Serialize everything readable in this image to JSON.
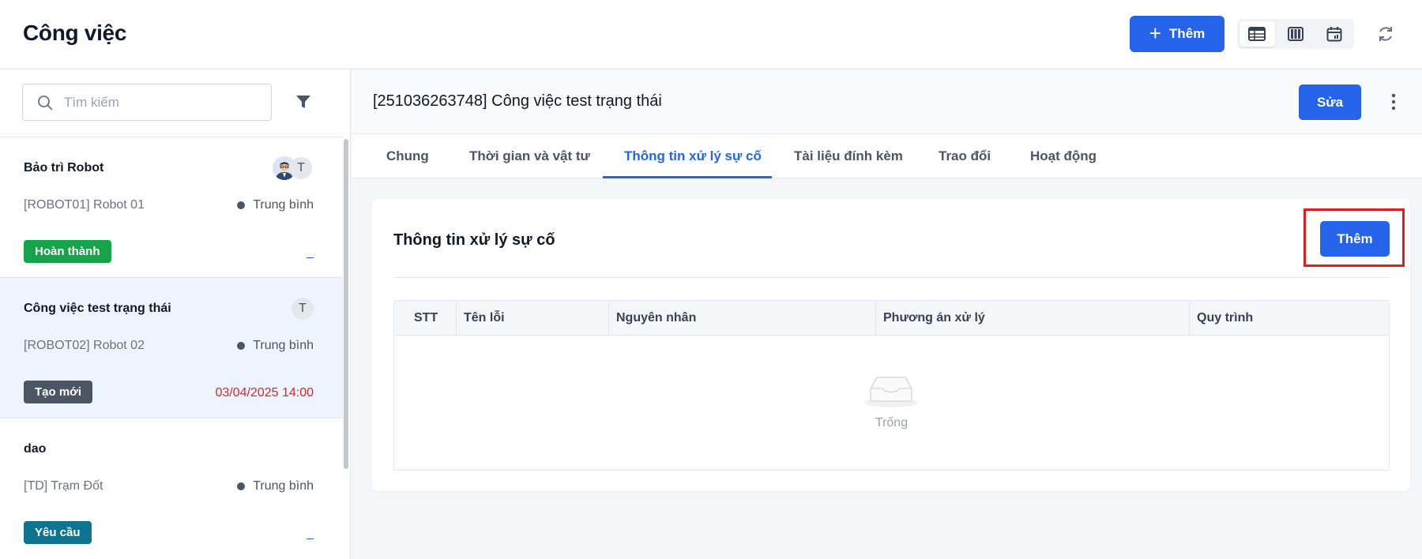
{
  "header": {
    "app_title": "Công việc",
    "add_label": "Thêm"
  },
  "search": {
    "placeholder": "Tìm kiếm"
  },
  "tasks": [
    {
      "title": "Bảo trì Robot",
      "asset": "[ROBOT01] Robot 01",
      "priority": "Trung bình",
      "status": "Hoàn thành",
      "status_color": "#16a34a",
      "date": "",
      "avatar_letter": "T"
    },
    {
      "title": "Công việc test trạng thái",
      "asset": "[ROBOT02] Robot 02",
      "priority": "Trung bình",
      "status": "Tạo mới",
      "status_color": "#4b5563",
      "date": "03/04/2025 14:00",
      "avatar_letter": "T"
    },
    {
      "title": "dao",
      "asset": "[TD] Trạm Đốt",
      "priority": "Trung bình",
      "status": "Yêu cầu",
      "status_color": "#0e7490",
      "date": "",
      "avatar_letter": ""
    }
  ],
  "detail": {
    "title": "[251036263748] Công việc test trạng thái",
    "edit_label": "Sửa",
    "tabs": [
      {
        "label": "Chung"
      },
      {
        "label": "Thời gian và vật tư"
      },
      {
        "label": "Thông tin xử lý sự cố"
      },
      {
        "label": "Tài liệu đính kèm"
      },
      {
        "label": "Trao đổi"
      },
      {
        "label": "Hoạt động"
      }
    ],
    "active_tab": "Thông tin xử lý sự cố"
  },
  "panel": {
    "title": "Thông tin xử lý sự cố",
    "add_label": "Thêm",
    "columns": [
      "STT",
      "Tên lỗi",
      "Nguyên nhân",
      "Phương án xử lý",
      "Quy trình"
    ],
    "empty_text": "Trống"
  },
  "colors": {
    "primary": "#2563eb",
    "highlight": "#e31b23",
    "date_red": "#dc2626",
    "dash_blue": "#2563eb"
  }
}
